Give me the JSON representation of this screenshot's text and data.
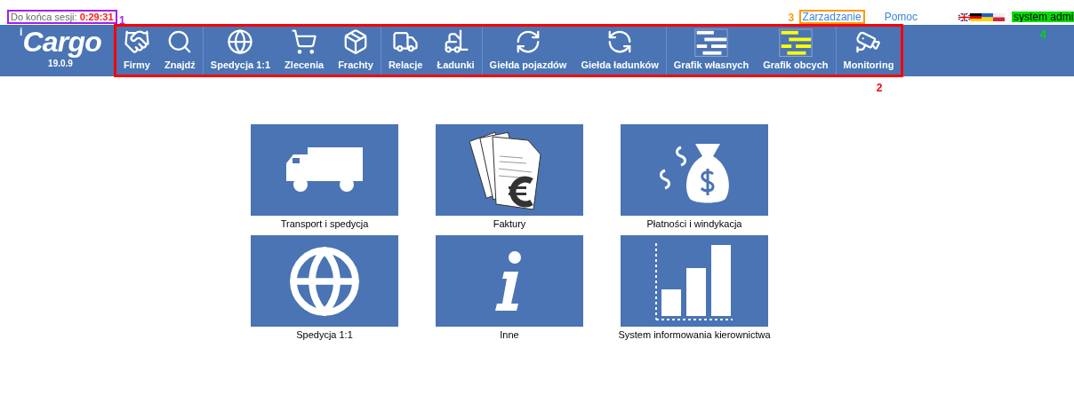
{
  "session": {
    "label": "Do końca sesji:",
    "time": "0:29:31",
    "marker": {
      "number": "1",
      "color": "#a020f0"
    }
  },
  "logo": {
    "prefix": "i",
    "text": "Cargo",
    "version": "19.0.9"
  },
  "nav": {
    "marker": {
      "number": "2",
      "color": "#ff0000"
    },
    "groups": [
      [
        {
          "label": "Firmy",
          "kind": "handshake"
        },
        {
          "label": "Znajdź",
          "kind": "search"
        }
      ],
      [
        {
          "label": "Spedycja 1:1",
          "kind": "globe"
        },
        {
          "label": "Zlecenia",
          "kind": "cart"
        },
        {
          "label": "Frachty",
          "kind": "package"
        }
      ],
      [
        {
          "label": "Relacje",
          "kind": "truck"
        },
        {
          "label": "Ładunki",
          "kind": "forklift"
        }
      ],
      [
        {
          "label": "Giełda pojazdów",
          "kind": "exchange-truck"
        },
        {
          "label": "Giełda ładunków",
          "kind": "exchange-package"
        }
      ],
      [
        {
          "label": "Grafik własnych",
          "kind": "schedule-white"
        },
        {
          "label": "Grafik obcych",
          "kind": "schedule-yellow"
        }
      ],
      [
        {
          "label": "Monitoring",
          "kind": "camera"
        }
      ]
    ]
  },
  "top_links": [
    {
      "label": "Zarzadzanie",
      "marker": {
        "number": "3",
        "color": "#ff9900"
      }
    },
    {
      "label": "Pomoc"
    }
  ],
  "user": {
    "name": "system admi",
    "marker": {
      "number": "4",
      "color": "#00dd00"
    }
  },
  "tiles": [
    {
      "label": "Transport i spedycja",
      "kind": "truck"
    },
    {
      "label": "Faktury",
      "kind": "invoice"
    },
    {
      "label": "Płatności i windykacja",
      "kind": "money"
    },
    {
      "label": "Spedycja 1:1",
      "kind": "globe"
    },
    {
      "label": "Inne",
      "kind": "info"
    },
    {
      "label": "System informowania kierownictwa",
      "kind": "bars"
    }
  ]
}
